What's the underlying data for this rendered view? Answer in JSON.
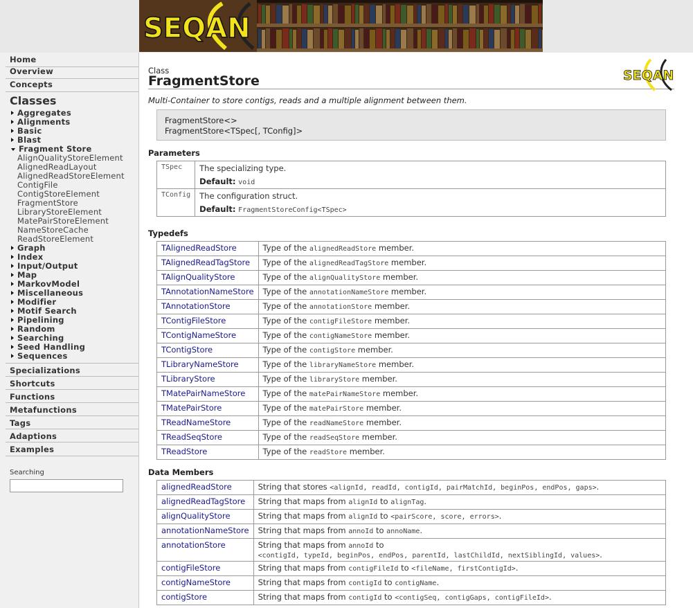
{
  "banner": {
    "logo_text": "SEQAN"
  },
  "sidebar": {
    "top_items": [
      "Home",
      "Overview",
      "Concepts"
    ],
    "classes_title": "Classes",
    "groups_before": [
      "Aggregates",
      "Alignments",
      "Basic",
      "Blast"
    ],
    "open_group": "Fragment Store",
    "open_group_items": [
      "AlignQualityStoreElement",
      "AlignedReadLayout",
      "AlignedReadStoreElement",
      "ContigFile",
      "ContigStoreElement",
      "FragmentStore",
      "LibraryStoreElement",
      "MatePairStoreElement",
      "NameStoreCache",
      "ReadStoreElement"
    ],
    "groups_after": [
      "Graph",
      "Index",
      "Input/Output",
      "Map",
      "MarkovModel",
      "Miscellaneous",
      "Modifier",
      "Motif Search",
      "Pipelining",
      "Random",
      "Searching",
      "Seed Handling",
      "Sequences"
    ],
    "bottom_items": [
      "Specializations",
      "Shortcuts",
      "Functions",
      "Metafunctions",
      "Tags",
      "Adaptions",
      "Examples"
    ],
    "search_label": "Searching",
    "search_value": ""
  },
  "page": {
    "kind": "Class",
    "title": "FragmentStore",
    "description": "Multi-Container to store contigs, reads and a multiple alignment between them.",
    "signature": [
      "FragmentStore<>",
      "FragmentStore<TSpec[, TConfig]>"
    ],
    "params_heading": "Parameters",
    "default_label": "Default:",
    "params": [
      {
        "name": "TSpec",
        "desc": "The specializing type.",
        "default": "void"
      },
      {
        "name": "TConfig",
        "desc": "The configuration struct.",
        "default": "FragmentStoreConfig<TSpec>"
      }
    ],
    "typedefs_heading": "Typedefs",
    "typedef_prefix": "Type of the",
    "typedef_suffix": "member.",
    "typedefs": [
      {
        "name": "TAlignedReadStore",
        "member": "alignedReadStore"
      },
      {
        "name": "TAlignedReadTagStore",
        "member": "alignedReadTagStore"
      },
      {
        "name": "TAlignQualityStore",
        "member": "alignQualityStore"
      },
      {
        "name": "TAnnotationNameStore",
        "member": "annotationNameStore"
      },
      {
        "name": "TAnnotationStore",
        "member": "annotationStore"
      },
      {
        "name": "TContigFileStore",
        "member": "contigFileStore"
      },
      {
        "name": "TContigNameStore",
        "member": "contigNameStore"
      },
      {
        "name": "TContigStore",
        "member": "contigStore"
      },
      {
        "name": "TLibraryNameStore",
        "member": "libraryNameStore"
      },
      {
        "name": "TLibraryStore",
        "member": "libraryStore"
      },
      {
        "name": "TMatePairNameStore",
        "member": "matePairNameStore"
      },
      {
        "name": "TMatePairStore",
        "member": "matePairStore"
      },
      {
        "name": "TReadNameStore",
        "member": "readNameStore"
      },
      {
        "name": "TReadSeqStore",
        "member": "readSeqStore"
      },
      {
        "name": "TReadStore",
        "member": "readStore"
      }
    ],
    "members_heading": "Data Members",
    "members": [
      {
        "name": "alignedReadStore",
        "parts": [
          [
            "t",
            "String that stores "
          ],
          [
            "c",
            "<alignId, readId, contigId, pairMatchId, beginPos, endPos, gaps>"
          ],
          [
            "t",
            "."
          ]
        ]
      },
      {
        "name": "alignedReadTagStore",
        "parts": [
          [
            "t",
            "String that maps from "
          ],
          [
            "c",
            "alignId"
          ],
          [
            "t",
            " to "
          ],
          [
            "c",
            "alignTag"
          ],
          [
            "t",
            "."
          ]
        ]
      },
      {
        "name": "alignQualityStore",
        "parts": [
          [
            "t",
            "String that maps from "
          ],
          [
            "c",
            "alignId"
          ],
          [
            "t",
            " to "
          ],
          [
            "c",
            "<pairScore, score, errors>"
          ],
          [
            "t",
            "."
          ]
        ]
      },
      {
        "name": "annotationNameStore",
        "parts": [
          [
            "t",
            "String that maps from "
          ],
          [
            "c",
            "annoId"
          ],
          [
            "t",
            " to "
          ],
          [
            "c",
            "annoName"
          ],
          [
            "t",
            "."
          ]
        ]
      },
      {
        "name": "annotationStore",
        "parts": [
          [
            "t",
            "String that maps from "
          ],
          [
            "c",
            "annoId"
          ],
          [
            "t",
            " to"
          ],
          [
            "br",
            ""
          ],
          [
            "c",
            "<contigId, typeId, beginPos, endPos, parentId, lastChildId, nextSiblingId, values>"
          ],
          [
            "t",
            "."
          ]
        ]
      },
      {
        "name": "contigFileStore",
        "parts": [
          [
            "t",
            "String that maps from "
          ],
          [
            "c",
            "contigFileId"
          ],
          [
            "t",
            " to "
          ],
          [
            "c",
            "<fileName, firstContigId>"
          ],
          [
            "t",
            "."
          ]
        ]
      },
      {
        "name": "contigNameStore",
        "parts": [
          [
            "t",
            "String that maps from "
          ],
          [
            "c",
            "contigId"
          ],
          [
            "t",
            " to "
          ],
          [
            "c",
            "contigName"
          ],
          [
            "t",
            "."
          ]
        ]
      },
      {
        "name": "contigStore",
        "parts": [
          [
            "t",
            "String that maps from "
          ],
          [
            "c",
            "contigId"
          ],
          [
            "t",
            " to "
          ],
          [
            "c",
            "<contigSeq, contigGaps, contigFileId>"
          ],
          [
            "t",
            "."
          ]
        ]
      }
    ]
  }
}
